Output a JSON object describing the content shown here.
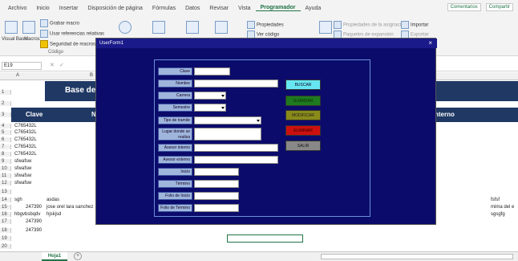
{
  "menu": [
    "Archivo",
    "Inicio",
    "Insertar",
    "Disposición de página",
    "Fórmulas",
    "Datos",
    "Revisar",
    "Vista",
    "Programador",
    "Ayuda"
  ],
  "menu_right": [
    "Comentarios",
    "Compartir"
  ],
  "ribbon": {
    "visual_basic": "Visual Basic",
    "macros": "Macros",
    "record_macro": "Grabar macro",
    "relative_refs": "Usar referencias relativas",
    "macro_security": "Seguridad de macros",
    "code_group": "Código",
    "properties": "Propiedades",
    "view_code": "Ver código",
    "map_props": "Propiedades de la asignación",
    "expansion_packs": "Paquetes de expansión",
    "import": "Importar",
    "export": "Exportar"
  },
  "formula_bar": {
    "name_box": "E19"
  },
  "columns": [
    "A",
    "B"
  ],
  "rows": [
    "1",
    "2",
    "3",
    "4",
    "5",
    "6",
    "7",
    "8",
    "9",
    "10",
    "11",
    "12",
    "13",
    "14",
    "15",
    "16",
    "17",
    "18",
    "19",
    "20"
  ],
  "sheet": {
    "banner_title": "Base de",
    "header_clave": "Clave",
    "header_n": "N",
    "header_interno": "nterno",
    "cells": [
      "C765432L",
      "C765432L",
      "C765432L",
      "C765432L",
      "C765432L",
      "sfwafsw",
      "sfwafsw",
      "sfwafsw",
      "sfwafsw"
    ],
    "row14_a": "sgh",
    "row14_b": "asdas",
    "row15_a": "247390",
    "row15_b": "jose orel lara sanchez",
    "row16_a": "hbgvbsbqdv",
    "row16_b": "hjskjsd",
    "row17_a": "247390",
    "row18_a": "247390",
    "right_14": "fsfsf",
    "right_15": "mima del e",
    "right_16": "sgsgfg"
  },
  "sheet_tab": "Hoja1",
  "add_sheet": "+",
  "userform": {
    "title": "UserForm1",
    "close": "×",
    "labels": {
      "clave": "Clave",
      "nombre": "Nombre",
      "carrera": "Carrera",
      "semestre": "Semestre",
      "tipo_tramite": "Tipo de tramite",
      "lugar": "Lugar donde se realiza",
      "asesor_interno": "Asesor interno",
      "asesor_externo": "Asesor externo",
      "inicio": "Inicio",
      "termino": "Término",
      "folio_inicio": "Folio de Inicio",
      "folio_termino": "Folio de Termino"
    },
    "buttons": {
      "buscar": "BUSCAR",
      "guardar": "GUARDAR",
      "modificar": "MODIFICAR",
      "eliminar": "ELIMINAR",
      "salir": "SALIR"
    },
    "button_colors": {
      "buscar": "#66e6f0",
      "guardar": "#1f7a1f",
      "modificar": "#8a8a1a",
      "eliminar": "#cc1010",
      "salir": "#888888"
    }
  }
}
